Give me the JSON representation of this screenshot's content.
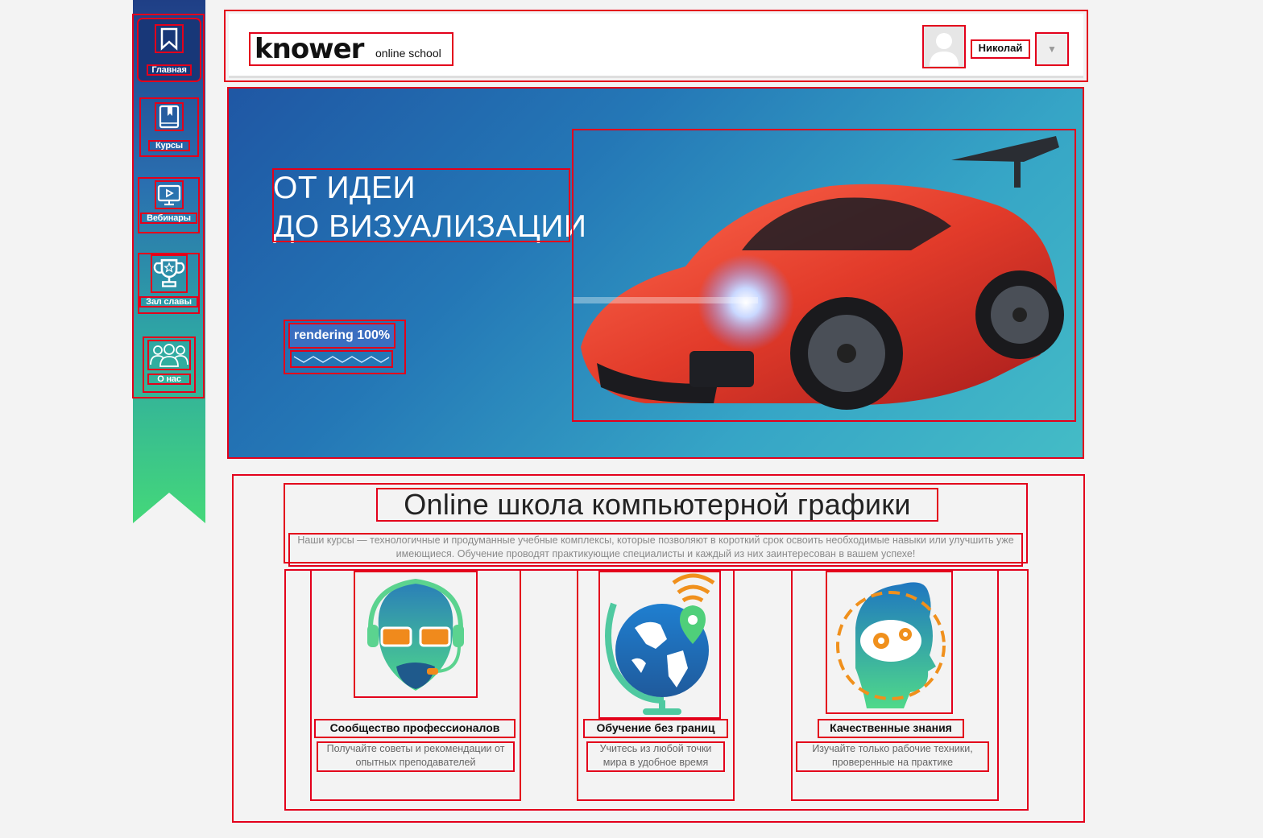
{
  "sidebar": {
    "items": [
      {
        "label": "Главная",
        "icon": "bookmark-icon"
      },
      {
        "label": "Курсы",
        "icon": "book-icon"
      },
      {
        "label": "Вебинары",
        "icon": "monitor-play-icon"
      },
      {
        "label": "Зал славы",
        "icon": "trophy-icon"
      },
      {
        "label": "О нас",
        "icon": "people-icon"
      }
    ]
  },
  "header": {
    "logo_main": "knower",
    "logo_sub": "online school",
    "username": "Николай",
    "dropdown_glyph": "▼"
  },
  "hero": {
    "title_line1": "ОТ ИДЕИ",
    "title_line2": "ДО ВИЗУАЛИЗАЦИИ",
    "badge": "rendering 100%"
  },
  "intro": {
    "title": "Online школа компьютерной графики",
    "text": "Наши курсы — технологичные и продуманные учебные комплексы, которые позволяют в короткий срок освоить необходимые навыки или улучшить уже имеющиеся. Обучение проводят практикующие специалисты и каждый из них заинтересован в вашем успехе!"
  },
  "features": [
    {
      "title": "Сообщество профессионалов",
      "text": "Получайте советы и рекомендации от опытных преподавателей",
      "icon": "headset-man-icon"
    },
    {
      "title": "Обучение без границ",
      "text": "Учитесь из любой точки мира в удобное время",
      "icon": "globe-location-icon"
    },
    {
      "title": "Качественные знания",
      "text": "Изучайте только рабочие техники, проверенные на практике",
      "icon": "head-gears-icon"
    }
  ],
  "colors": {
    "sidebar_top": "#1f3f86",
    "sidebar_bottom": "#44d879",
    "annotation": "#e3001b",
    "hero_start": "#1f57a4",
    "hero_end": "#44bcc6"
  }
}
